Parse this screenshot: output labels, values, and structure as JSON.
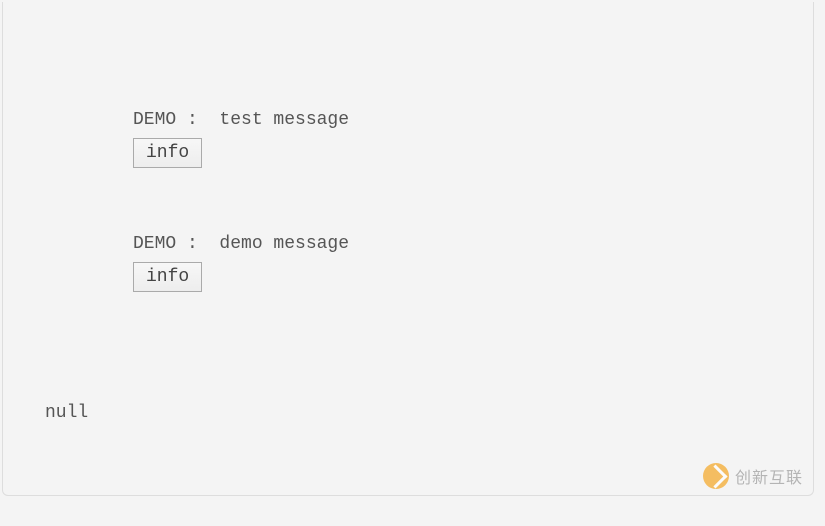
{
  "blocks": [
    {
      "label": "DEMO :  test message",
      "button_label": "info"
    },
    {
      "label": "DEMO :  demo message",
      "button_label": "info"
    }
  ],
  "null_text": "null",
  "watermark": {
    "text": "创新互联"
  }
}
